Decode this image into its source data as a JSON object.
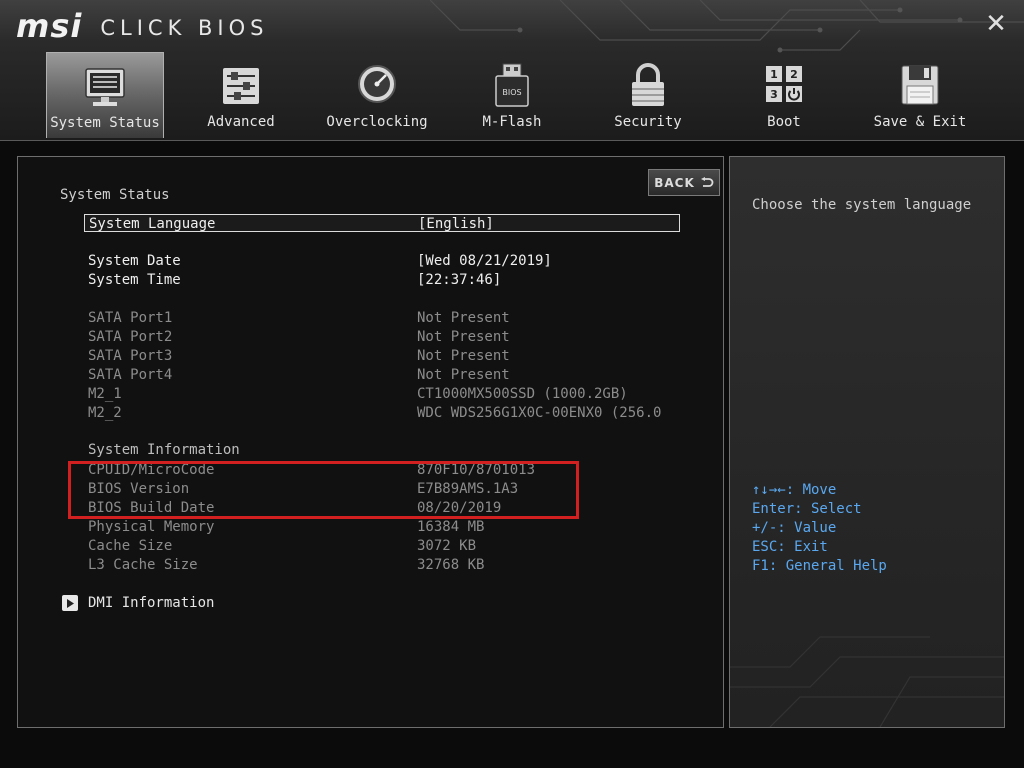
{
  "app": {
    "brand_logo": "msi",
    "brand_title": "CLICK BIOS",
    "close_icon": "close-icon"
  },
  "tabs": [
    {
      "label": "System Status",
      "icon": "monitor-icon",
      "active": true
    },
    {
      "label": "Advanced",
      "icon": "sliders-icon",
      "active": false
    },
    {
      "label": "Overclocking",
      "icon": "gauge-icon",
      "active": false
    },
    {
      "label": "M-Flash",
      "icon": "usb-bios-icon",
      "active": false
    },
    {
      "label": "Security",
      "icon": "lock-icon",
      "active": false
    },
    {
      "label": "Boot",
      "icon": "boot-order-icon",
      "active": false
    },
    {
      "label": "Save & Exit",
      "icon": "floppy-disk-icon",
      "active": false
    }
  ],
  "boot_icon_digits": [
    "1",
    "2",
    "3"
  ],
  "m_flash_icon_text": "BIOS",
  "main": {
    "title": "System Status",
    "back_label": "BACK",
    "settings": [
      {
        "label": "System Language",
        "value": "[English]",
        "selected": true
      },
      {
        "label": "System Date",
        "value": "[Wed 08/21/2019]"
      },
      {
        "label": "System Time",
        "value": "[22:37:46]"
      }
    ],
    "ports": [
      {
        "label": "SATA Port1",
        "value": "Not Present"
      },
      {
        "label": "SATA Port2",
        "value": "Not Present"
      },
      {
        "label": "SATA Port3",
        "value": "Not Present"
      },
      {
        "label": "SATA Port4",
        "value": "Not Present"
      },
      {
        "label": "M2_1",
        "value": "CT1000MX500SSD (1000.2GB)"
      },
      {
        "label": "M2_2",
        "value": "WDC WDS256G1X0C-00ENX0 (256.0"
      }
    ],
    "system_info_title": "System Information",
    "system_info": [
      {
        "label": "CPUID/MicroCode",
        "value": "870F10/8701013"
      },
      {
        "label": "BIOS Version",
        "value": "E7B89AMS.1A3"
      },
      {
        "label": "BIOS Build Date",
        "value": "08/20/2019"
      },
      {
        "label": "Physical Memory",
        "value": "16384 MB"
      },
      {
        "label": "Cache Size",
        "value": "3072 KB"
      },
      {
        "label": "L3 Cache Size",
        "value": "32768 KB"
      }
    ],
    "dmi_label": "DMI Information"
  },
  "help": {
    "description": "Choose the system language",
    "keys": {
      "move": "↑↓→←: Move",
      "select": "Enter: Select",
      "value": "+/-: Value",
      "exit": "ESC: Exit",
      "help": "F1: General Help"
    }
  },
  "colors": {
    "accent_blue": "#5aa8f0",
    "highlight_red": "#d21f1f"
  }
}
